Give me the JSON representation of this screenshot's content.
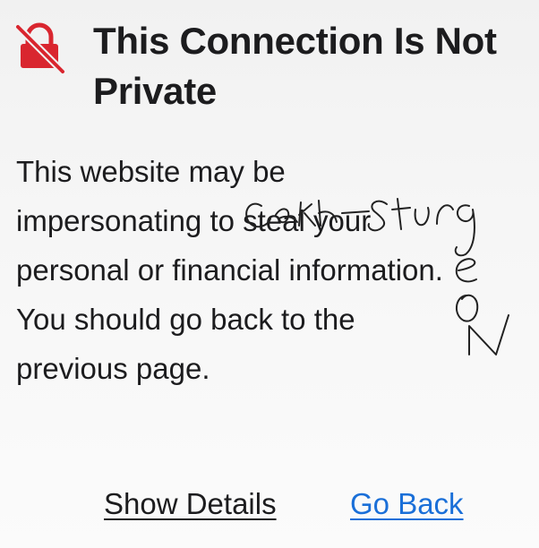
{
  "title": "This Connection Is Not Private",
  "body": "This website may be impersonating to steal your personal or financial information. You should go back to the previous page.",
  "actions": {
    "details_label": "Show Details",
    "back_label": "Go Back"
  },
  "icons": {
    "warning": "lock-crossed-icon"
  },
  "colors": {
    "warning_red": "#d9262f",
    "link_blue": "#1a6fd8",
    "text": "#1c1c1e"
  }
}
